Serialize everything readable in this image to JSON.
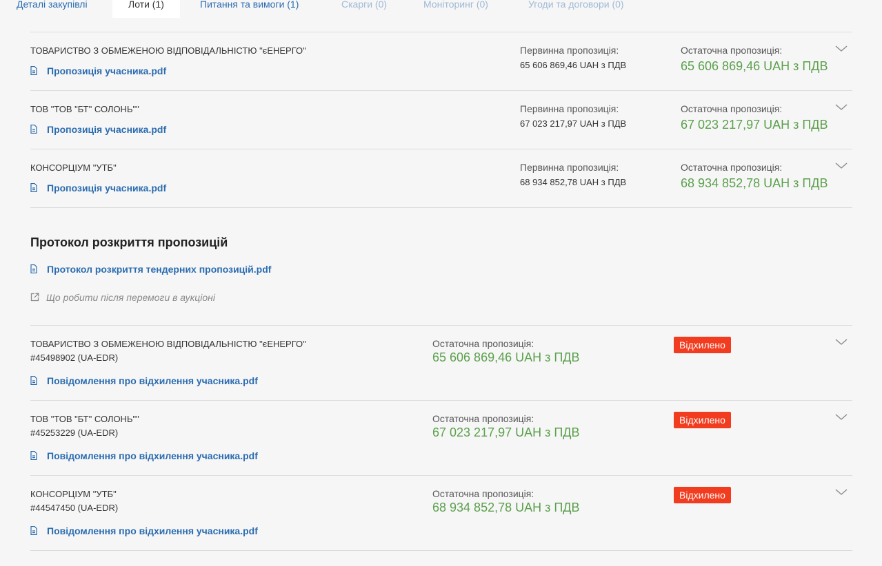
{
  "tabs": [
    {
      "label": "Деталі закупівлі",
      "state": "link"
    },
    {
      "label": "Лоти (1)",
      "state": "active"
    },
    {
      "label": "Питання та вимоги (1)",
      "state": "link"
    },
    {
      "label": "Скарги (0)",
      "state": "disabled"
    },
    {
      "label": "Моніторинг (0)",
      "state": "disabled"
    },
    {
      "label": "Угоди та договори (0)",
      "state": "disabled"
    }
  ],
  "bids": [
    {
      "name": "ТОВАРИСТВО З ОБМЕЖЕНОЮ ВІДПОВІДАЛЬНІСТЮ \"єЕНЕРГО\"",
      "file": "Пропозиція учасника.pdf",
      "initial_label": "Первинна пропозиція:",
      "initial_value": "65 606 869,46 UAH з ПДВ",
      "final_label": "Остаточна пропозиція:",
      "final_value": "65 606 869,46 UAH з ПДВ"
    },
    {
      "name": "ТОВ \"ТОВ \"БТ\" СОЛОНЬ\"\"",
      "file": "Пропозиція учасника.pdf",
      "initial_label": "Первинна пропозиція:",
      "initial_value": "67 023 217,97 UAH з ПДВ",
      "final_label": "Остаточна пропозиція:",
      "final_value": "67 023 217,97 UAH з ПДВ"
    },
    {
      "name": "КОНСОРЦІУМ \"УТБ\"",
      "file": "Пропозиція учасника.pdf",
      "initial_label": "Первинна пропозиція:",
      "initial_value": "68 934 852,78 UAH з ПДВ",
      "final_label": "Остаточна пропозиція:",
      "final_value": "68 934 852,78 UAH з ПДВ"
    }
  ],
  "protocol": {
    "title": "Протокол розкриття пропозицій",
    "file": "Протокол розкриття тендерних пропозицій.pdf",
    "hint": "Що робити після перемоги в аукціоні"
  },
  "qualifications": [
    {
      "name": "ТОВАРИСТВО З ОБМЕЖЕНОЮ ВІДПОВІДАЛЬНІСТЮ \"єЕНЕРГО\"",
      "edr": "#45498902 (UA-EDR)",
      "final_label": "Остаточна пропозиція:",
      "final_value": "65 606 869,46 UAH з ПДВ",
      "status": "Відхилено",
      "file": "Повідомлення про відхилення учасника.pdf"
    },
    {
      "name": "ТОВ \"ТОВ \"БТ\" СОЛОНЬ\"\"",
      "edr": "#45253229 (UA-EDR)",
      "final_label": "Остаточна пропозиція:",
      "final_value": "67 023 217,97 UAH з ПДВ",
      "status": "Відхилено",
      "file": "Повідомлення про відхилення учасника.pdf"
    },
    {
      "name": "КОНСОРЦІУМ \"УТБ\"",
      "edr": "#44547450 (UA-EDR)",
      "final_label": "Остаточна пропозиція:",
      "final_value": "68 934 852,78 UAH з ПДВ",
      "status": "Відхилено",
      "file": "Повідомлення про відхилення учасника.pdf"
    }
  ],
  "colors": {
    "link": "#2b6cb0",
    "price": "#5ba04c",
    "rejected": "#f13c1f"
  }
}
